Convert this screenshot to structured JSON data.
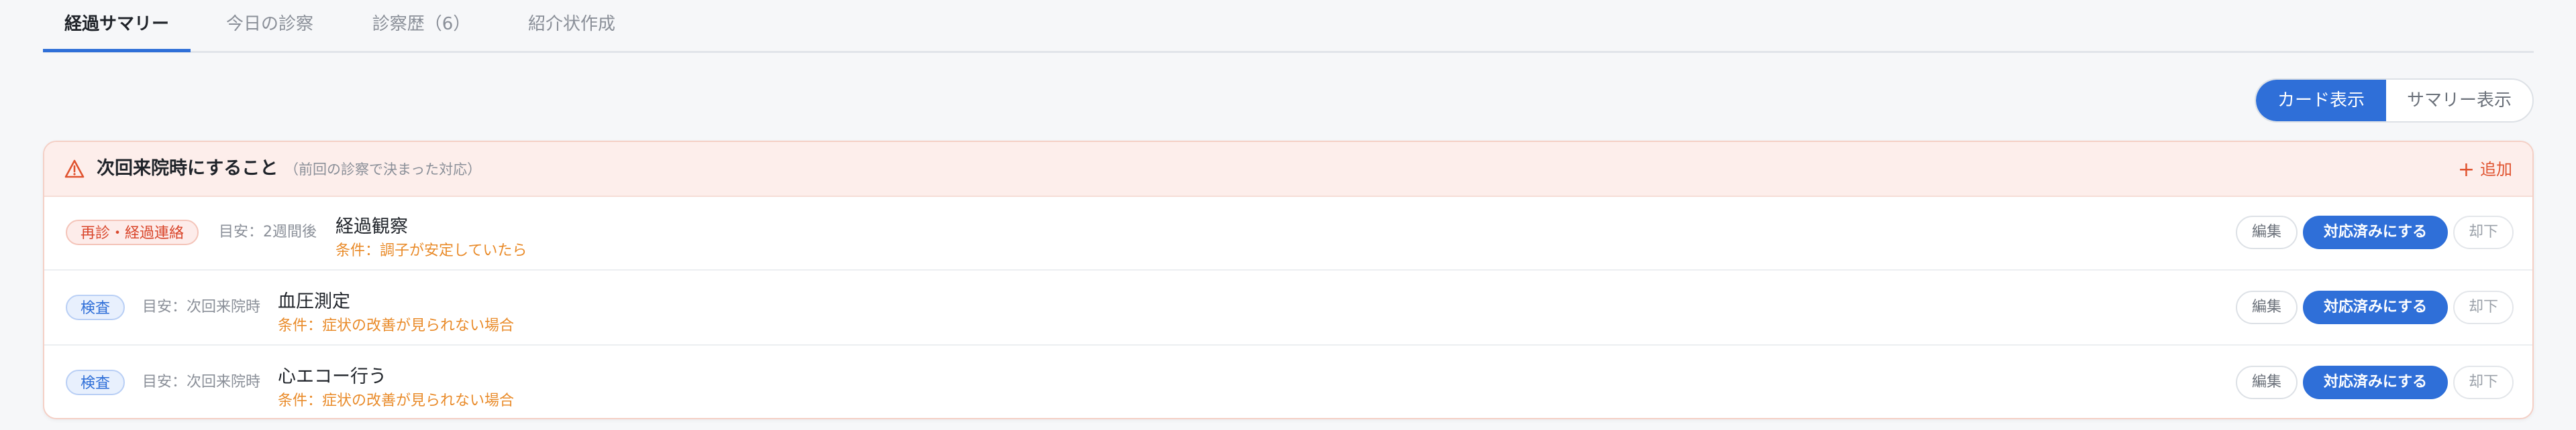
{
  "tabs": [
    {
      "label": "経過サマリー",
      "active": true
    },
    {
      "label": "今日の診察",
      "active": false
    },
    {
      "label": "診察歴（6）",
      "active": false
    },
    {
      "label": "紹介状作成",
      "active": false
    }
  ],
  "view_toggle": {
    "card_label": "カード表示",
    "summary_label": "サマリー表示",
    "selected": "カード表示"
  },
  "next_visit": {
    "title": "次回来院時にすること",
    "subtitle": "（前回の診察で決まった対応）",
    "add_label": "追加",
    "items": [
      {
        "tag": "再診・経過連絡",
        "guide": "目安：2週間後",
        "title": "経過観察",
        "condition": "条件：調子が安定していたら"
      },
      {
        "tag": "検査",
        "guide": "目安：次回来院時",
        "title": "血圧測定",
        "condition": "条件：症状の改善が見られない場合"
      },
      {
        "tag": "検査",
        "guide": "目安：次回来院時",
        "title": "心エコー行う",
        "condition": "条件：症状の改善が見られない場合"
      }
    ],
    "buttons": {
      "edit": "編集",
      "done": "対応済みにする",
      "reject": "却下"
    }
  },
  "colors": {
    "accent": "#2f6fd8",
    "alert": "#e0532f",
    "condition": "#e98b2a"
  }
}
